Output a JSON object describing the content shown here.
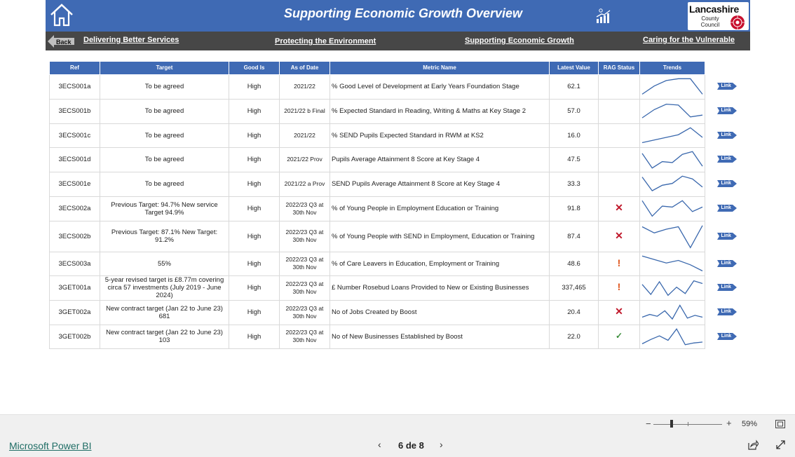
{
  "header": {
    "title": "Supporting Economic Growth Overview",
    "home_icon": "home-icon",
    "chart_icon": "growth-chart-icon",
    "logo": {
      "line1": "Lancashire",
      "line2": "County",
      "line3": "Council"
    }
  },
  "nav": {
    "back_label": "Back",
    "links": [
      "Delivering Better Services",
      "Protecting the Environment",
      "Supporting Economic Growth",
      "Caring for the Vulnerable"
    ]
  },
  "table": {
    "columns": [
      "Ref",
      "Target",
      "Good Is",
      "As of Date",
      "Metric Name",
      "Latest Value",
      "RAG Status",
      "Trends"
    ],
    "link_label": "Link",
    "rows": [
      {
        "ref": "3ECS001a",
        "target": "To be agreed",
        "good_is": "High",
        "as_of": "2021/22",
        "metric": "% Good Level of Development at Early Years Foundation Stage",
        "latest": "62.1",
        "rag": "",
        "trend": [
          0.1,
          0.55,
          0.85,
          0.95,
          0.95,
          0.1
        ]
      },
      {
        "ref": "3ECS001b",
        "target": "To be agreed",
        "good_is": "High",
        "as_of": "2021/22 b Final",
        "metric": "% Expected Standard in Reading, Writing & Maths at Key Stage 2",
        "latest": "57.0",
        "rag": "",
        "trend": [
          0.15,
          0.6,
          0.9,
          0.85,
          0.2,
          0.3
        ]
      },
      {
        "ref": "3ECS001c",
        "target": "To be agreed",
        "good_is": "High",
        "as_of": "2021/22",
        "metric": "% SEND Pupils Expected Standard in RWM at KS2",
        "latest": "16.0",
        "rag": "",
        "trend": [
          0.1,
          0.25,
          0.4,
          0.55,
          0.95,
          0.4
        ]
      },
      {
        "ref": "3ECS001d",
        "target": "To be agreed",
        "good_is": "High",
        "as_of": "2021/22 Prov",
        "metric": "Pupils Average Attainment 8 Score at Key Stage 4",
        "latest": "47.5",
        "rag": "",
        "trend": [
          0.85,
          0.05,
          0.4,
          0.35,
          0.8,
          0.95,
          0.15
        ]
      },
      {
        "ref": "3ECS001e",
        "target": "To be agreed",
        "good_is": "High",
        "as_of": "2021/22 a Prov",
        "metric": "SEND Pupils Average Attainment 8 Score at Key Stage 4",
        "latest": "33.3",
        "rag": "",
        "trend": [
          0.9,
          0.15,
          0.45,
          0.55,
          0.95,
          0.8,
          0.35
        ]
      },
      {
        "ref": "3ECS002a",
        "target": "Previous Target: 94.7% New service Target 94.9%",
        "good_is": "High",
        "as_of": "2022/23 Q3 at 30th Nov",
        "metric": "% of Young People in Employment Education or Training",
        "latest": "91.8",
        "rag": "red-cross",
        "trend": [
          0.95,
          0.1,
          0.65,
          0.6,
          0.95,
          0.35,
          0.6
        ]
      },
      {
        "ref": "3ECS002b",
        "target": "Previous Target: 87.1% New Target: 91.2%",
        "good_is": "High",
        "as_of": "2022/23 Q3 at 30th Nov",
        "metric": "% of Young People with SEND in Employment, Education or Training",
        "latest": "87.4",
        "rag": "red-cross",
        "trend": [
          0.9,
          0.65,
          0.8,
          0.9,
          0.05,
          0.95
        ]
      },
      {
        "ref": "3ECS003a",
        "target": "55%",
        "good_is": "High",
        "as_of": "2022/23 Q3 at 30th Nov",
        "metric": "% of Care Leavers in Education, Employment or Training",
        "latest": "48.6",
        "rag": "amber-exclamation",
        "trend": [
          0.95,
          0.75,
          0.55,
          0.7,
          0.45,
          0.1
        ]
      },
      {
        "ref": "3GET001a",
        "target": "5-year revised target is £8.77m covering circa 57 investments (July 2019 - June 2024)",
        "good_is": "High",
        "as_of": "2022/23 Q3 at 30th Nov",
        "metric": "£ Number Rosebud Loans Provided to New or Existing Businesses",
        "latest": "337,465",
        "rag": "amber-exclamation",
        "trend": [
          0.7,
          0.15,
          0.85,
          0.1,
          0.55,
          0.2,
          0.9,
          0.75
        ]
      },
      {
        "ref": "3GET002a",
        "target": "New contract target (Jan 22 to June 23) 681",
        "good_is": "High",
        "as_of": "2022/23 Q3 at 30th Nov",
        "metric": "No of Jobs Created by Boost",
        "latest": "20.4",
        "rag": "red-cross",
        "trend": [
          0.25,
          0.4,
          0.3,
          0.6,
          0.15,
          0.9,
          0.2,
          0.35,
          0.25
        ]
      },
      {
        "ref": "3GET002b",
        "target": "New contract target (Jan 22 to June 23) 103",
        "good_is": "High",
        "as_of": "2022/23 Q3 at 30th Nov",
        "metric": "No of New Businesses Established by Boost",
        "latest": "22.0",
        "rag": "green-check",
        "trend": [
          0.1,
          0.35,
          0.55,
          0.3,
          0.95,
          0.05,
          0.15,
          0.2
        ]
      }
    ]
  },
  "footer": {
    "brand": "Microsoft Power BI",
    "page_indicator": "6 de 8",
    "zoom_value": "59%",
    "zoom_level_percent": 59
  },
  "colors": {
    "header_blue": "#3f6ab4",
    "nav_gray": "#474747",
    "trend_line": "#3a68ad",
    "rag_red": "#c0182b",
    "rag_amber": "#e0541a",
    "rag_green": "#3a8d3a"
  }
}
